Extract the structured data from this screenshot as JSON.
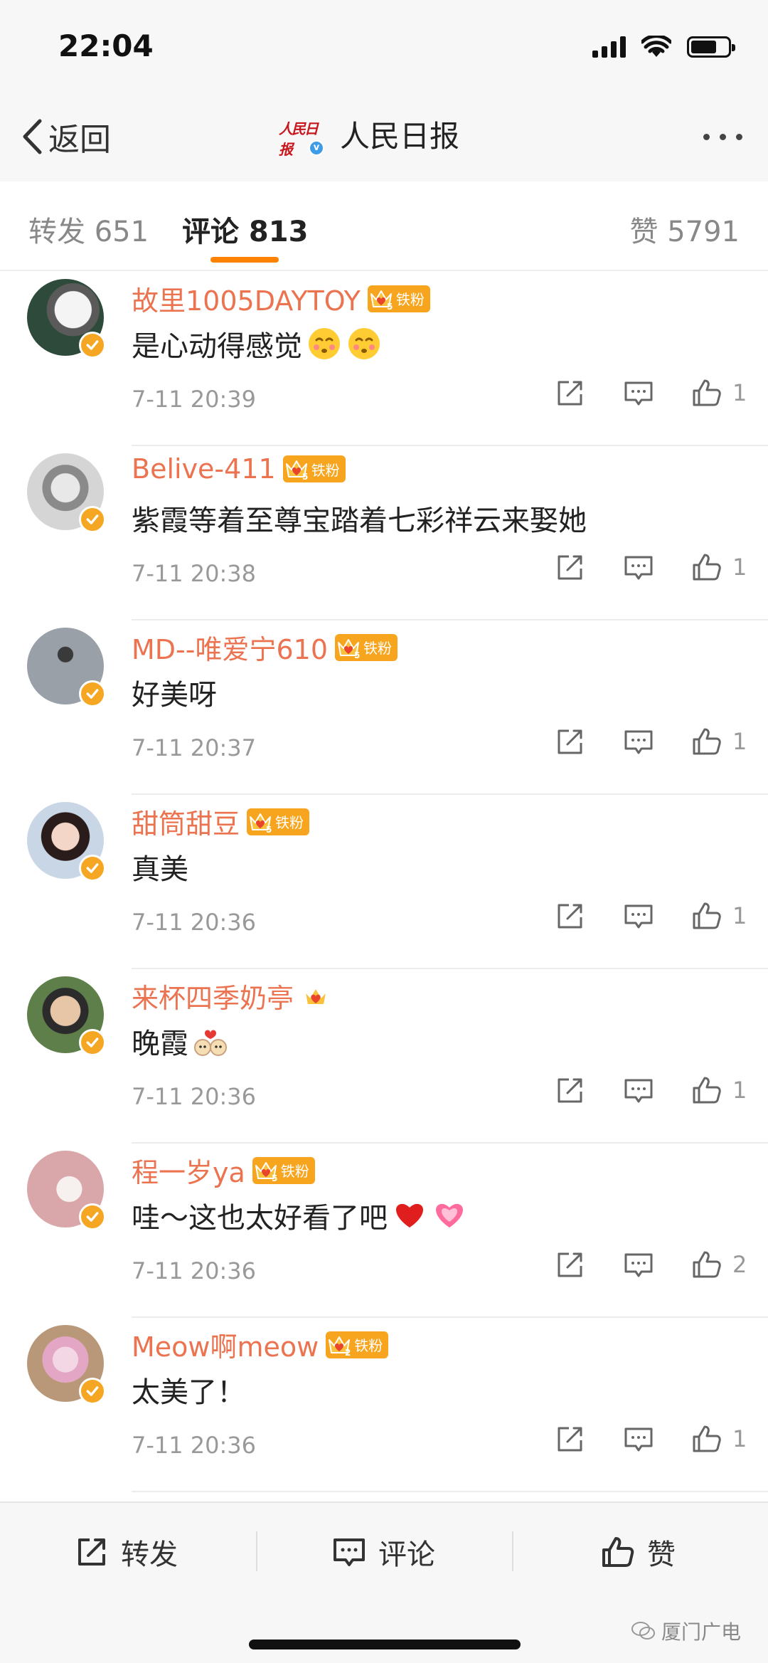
{
  "status": {
    "time": "22:04"
  },
  "nav": {
    "back_label": "返回",
    "logo_text": "人民日报",
    "title": "人民日报"
  },
  "tabs": [
    {
      "label": "转发 651"
    },
    {
      "label": "评论 813"
    },
    {
      "label": "赞 5791"
    }
  ],
  "fan_label": "铁粉",
  "comments": [
    {
      "username": "故里1005DAYTOY",
      "fan_level": "5",
      "text": "是心动得感觉",
      "emojis": [
        "blush",
        "blush"
      ],
      "time": "7-11 20:39",
      "likes": "1"
    },
    {
      "username": "Belive-411",
      "fan_level": "5",
      "text": "紫霞等着至尊宝踏着七彩祥云来娶她",
      "emojis": [],
      "time": "7-11 20:38",
      "likes": "1"
    },
    {
      "username": "MD--唯爱宁610",
      "fan_level": "5",
      "text": "好美呀",
      "emojis": [],
      "time": "7-11 20:37",
      "likes": "1"
    },
    {
      "username": "甜筒甜豆",
      "fan_level": "5",
      "text": "真美",
      "emojis": [],
      "time": "7-11 20:36",
      "likes": "1"
    },
    {
      "username": "来杯四季奶亭",
      "fan_level": "4",
      "text": "晚霞",
      "emojis": [
        "couple"
      ],
      "time": "7-11 20:36",
      "likes": "1"
    },
    {
      "username": "程一岁ya",
      "fan_level": "5",
      "text": "哇～这也太好看了吧",
      "emojis": [
        "heart",
        "heart-glow"
      ],
      "time": "7-11 20:36",
      "likes": "2"
    },
    {
      "username": "Meow啊meow",
      "fan_level": "2",
      "text": "太美了！",
      "emojis": [],
      "time": "7-11 20:36",
      "likes": "1"
    }
  ],
  "bottom": {
    "repost": "转发",
    "comment": "评论",
    "like": "赞",
    "watermark": "厦门广电"
  },
  "colors": {
    "accent": "#ff8200",
    "username": "#eb7350",
    "fan_badge": "#f7a51e",
    "verified": "#f5a623"
  }
}
